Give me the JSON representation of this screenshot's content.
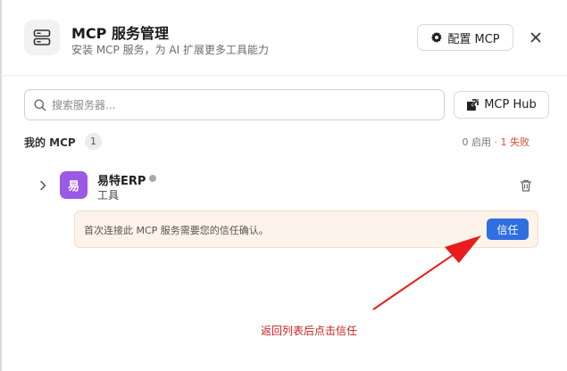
{
  "header": {
    "title": "MCP 服务管理",
    "subtitle": "安装 MCP 服务，为 AI 扩展更多工具能力",
    "app_icon": "server-icon",
    "config_button_label": "配置 MCP",
    "config_icon": "gear-icon",
    "close_icon": "close-icon"
  },
  "search": {
    "placeholder": "搜索服务器...",
    "value": "",
    "icon": "search-icon"
  },
  "hub_button": {
    "label": "MCP Hub",
    "icon": "external-link-icon"
  },
  "my_mcp": {
    "title": "我的 MCP",
    "count": "1",
    "status_enabled": "0 启用 · ",
    "status_failed": "1 失败"
  },
  "servers": [
    {
      "avatar_char": "易",
      "name": "易特ERP",
      "type": "工具",
      "status": "inactive",
      "trust_notice": "首次连接此 MCP 服务需要您的信任确认。",
      "trust_button_label": "信任"
    }
  ],
  "annotation": {
    "text": "返回列表后点击信任"
  },
  "colors": {
    "accent_blue": "#2f6fe0",
    "avatar_purple": "#9b59e6",
    "failed_red": "#e04a3a",
    "annotation_red": "#e81c1c",
    "trust_bg": "#fdf3ea"
  }
}
